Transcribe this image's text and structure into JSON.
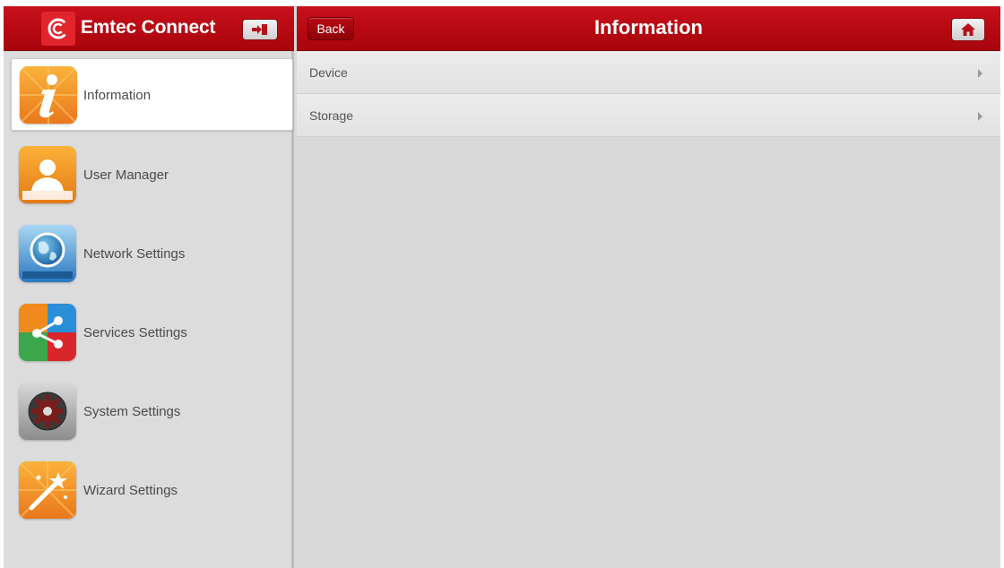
{
  "app": {
    "title": "Emtec Connect",
    "brand_color": "#c40f19",
    "logo_icon": "emtec-logo-icon",
    "logout_icon": "logout-icon"
  },
  "sidebar": {
    "items": [
      {
        "label": "Information",
        "icon": "information-icon",
        "active": true
      },
      {
        "label": "User Manager",
        "icon": "user-manager-icon",
        "active": false
      },
      {
        "label": "Network Settings",
        "icon": "network-globe-icon",
        "active": false
      },
      {
        "label": "Services Settings",
        "icon": "share-services-icon",
        "active": false
      },
      {
        "label": "System Settings",
        "icon": "system-gear-icon",
        "active": false
      },
      {
        "label": "Wizard Settings",
        "icon": "wizard-wand-icon",
        "active": false
      }
    ]
  },
  "header": {
    "back_label": "Back",
    "title": "Information",
    "home_icon": "home-icon"
  },
  "main": {
    "rows": [
      {
        "label": "Device"
      },
      {
        "label": "Storage"
      }
    ]
  }
}
